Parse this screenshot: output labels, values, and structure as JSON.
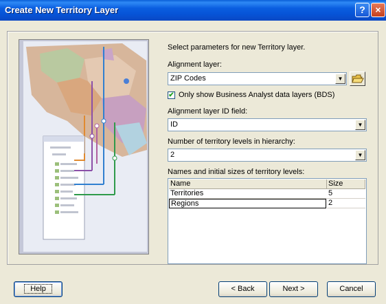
{
  "window": {
    "title": "Create New Territory Layer",
    "help_glyph": "?",
    "close_glyph": "×"
  },
  "intro": "Select parameters for new Territory layer.",
  "alignment_layer": {
    "label": "Alignment layer:",
    "value": "ZIP Codes"
  },
  "bds_checkbox": {
    "checked": true,
    "label": "Only show Business Analyst data layers (BDS)"
  },
  "id_field": {
    "label": "Alignment layer ID field:",
    "value": "ID"
  },
  "levels": {
    "label": "Number of territory levels in hierarchy:",
    "value": "2"
  },
  "names_table": {
    "label": "Names and initial sizes of territory levels:",
    "columns": [
      "Name",
      "Size"
    ],
    "rows": [
      {
        "name": "Territories",
        "size": "5"
      },
      {
        "name": "Regions",
        "size": "2"
      }
    ]
  },
  "buttons": {
    "help": "Help",
    "back": "< Back",
    "next": "Next >",
    "cancel": "Cancel"
  },
  "icons": {
    "dropdown": "chevron-down-icon",
    "open": "open-folder-icon",
    "check": "check-icon"
  },
  "colors": {
    "titlebar": "#0a5ee0",
    "dialog_bg": "#ece9d8",
    "field_border": "#7f9db9"
  }
}
